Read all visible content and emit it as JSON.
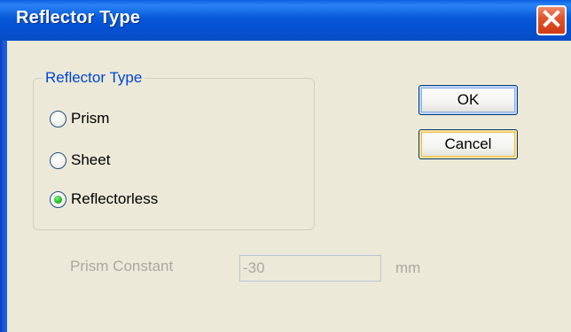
{
  "window": {
    "title": "Reflector Type",
    "close_icon": "close-icon"
  },
  "reflector_group": {
    "title": "Reflector Type",
    "options": [
      {
        "label": "Prism",
        "checked": false
      },
      {
        "label": "Sheet",
        "checked": false
      },
      {
        "label": "Reflectorless",
        "checked": true
      }
    ]
  },
  "buttons": {
    "ok_label": "OK",
    "cancel_label": "Cancel"
  },
  "prism_constant": {
    "label": "Prism Constant",
    "value": "-30",
    "unit": "mm",
    "enabled": false
  },
  "colors": {
    "titlebar": "#0758d8",
    "close_button": "#e2552b",
    "group_title": "#0046d5",
    "dialog_background": "#ece9d8",
    "disabled_text": "#a9a99e",
    "radio_selected": "#22c022"
  }
}
